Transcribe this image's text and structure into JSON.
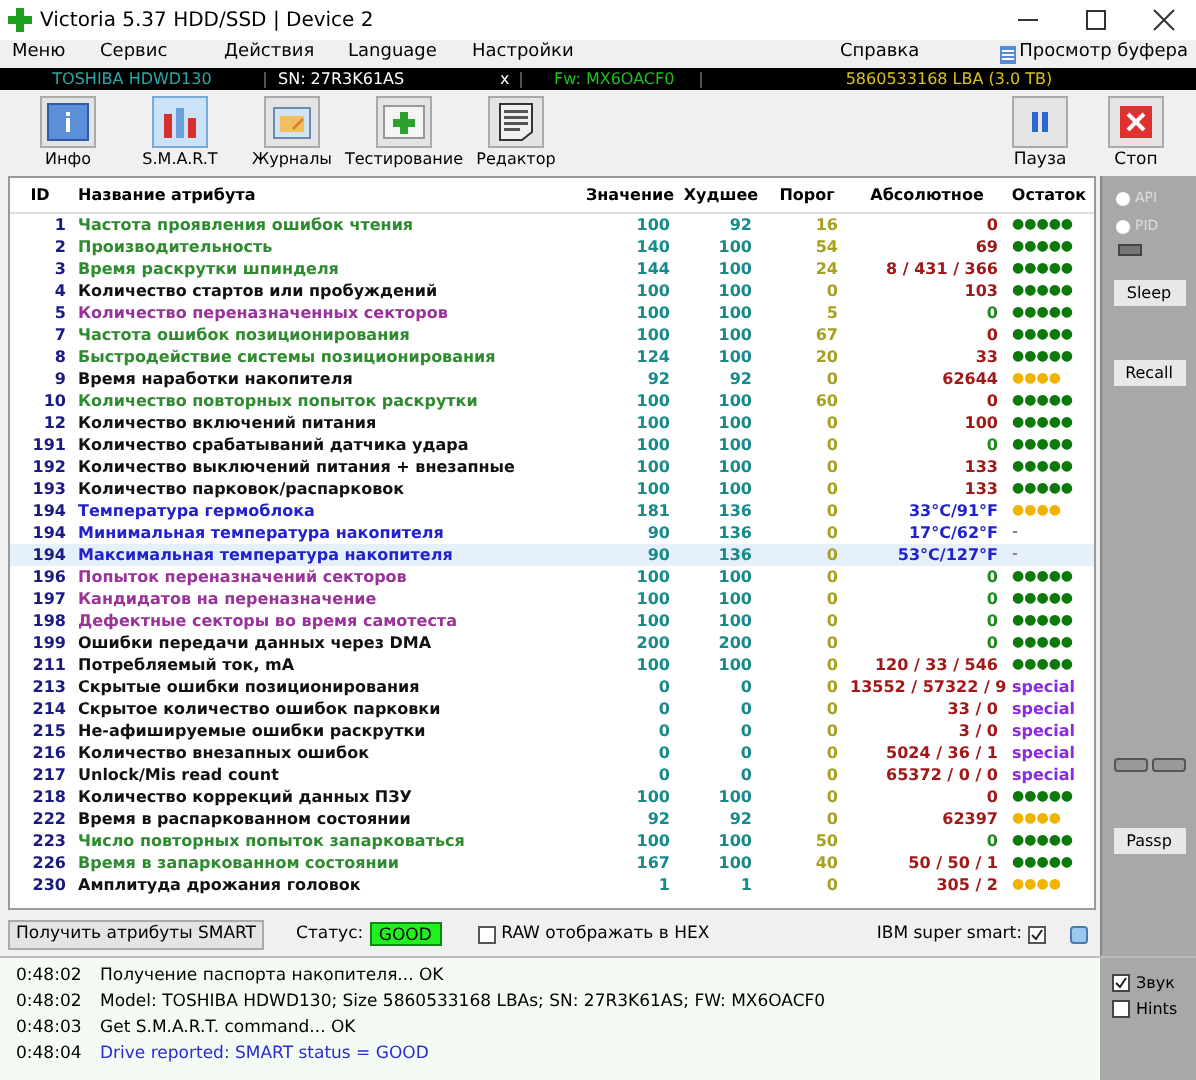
{
  "window": {
    "title": "Victoria 5.37 HDD/SSD | Device 2"
  },
  "menu": [
    "Меню",
    "Сервис",
    "Действия",
    "Language",
    "Настройки",
    "Справка"
  ],
  "clipboard_button": "Просмотр буфера",
  "drive_bar": {
    "model": "TOSHIBA HDWD130",
    "serial": "SN: 27R3K61AS",
    "close": "x",
    "firmware": "Fw: MX6OACF0",
    "capacity": "5860533168 LBA (3.0 TB)"
  },
  "toolbar": [
    {
      "label": "Инфо",
      "kind": "info",
      "selected": false
    },
    {
      "label": "S.M.A.R.T",
      "kind": "smart",
      "selected": true
    },
    {
      "label": "Журналы",
      "kind": "logs",
      "selected": false
    },
    {
      "label": "Тестирование",
      "kind": "test",
      "selected": false
    },
    {
      "label": "Редактор",
      "kind": "editor",
      "selected": false
    }
  ],
  "toolbar_right": [
    {
      "label": "Пауза",
      "kind": "pause"
    },
    {
      "label": "Стоп",
      "kind": "stop"
    }
  ],
  "table": {
    "columns": [
      "ID",
      "Название атрибута",
      "Значение",
      "Худшее",
      "Порог",
      "Абсолютное",
      "Остаток"
    ],
    "rows": [
      {
        "id": "1",
        "name": "Частота проявления ошибок чтения",
        "color": "#2e8b2e",
        "value": "100",
        "worst": "92",
        "threshold": "16",
        "raw": {
          "text": "0",
          "kind": "bad"
        },
        "remainder": {
          "text": "●●●●●",
          "kind": "good"
        },
        "selected": false
      },
      {
        "id": "2",
        "name": "Производительность",
        "color": "#2e8b2e",
        "value": "140",
        "worst": "100",
        "threshold": "54",
        "raw": {
          "text": "69",
          "kind": "bad"
        },
        "remainder": {
          "text": "●●●●●",
          "kind": "good"
        },
        "selected": false
      },
      {
        "id": "3",
        "name": "Время раскрутки шпинделя",
        "color": "#2e8b2e",
        "value": "144",
        "worst": "100",
        "threshold": "24",
        "raw": {
          "text": "8 / 431 / 366",
          "kind": "bad"
        },
        "remainder": {
          "text": "●●●●●",
          "kind": "good"
        },
        "selected": false
      },
      {
        "id": "4",
        "name": "Количество стартов или пробуждений",
        "color": "#111111",
        "value": "100",
        "worst": "100",
        "threshold": "0",
        "raw": {
          "text": "103",
          "kind": "bad"
        },
        "remainder": {
          "text": "●●●●●",
          "kind": "good"
        },
        "selected": false
      },
      {
        "id": "5",
        "name": "Количество переназначенных секторов",
        "color": "#993399",
        "value": "100",
        "worst": "100",
        "threshold": "5",
        "raw": {
          "text": "0",
          "kind": "ok"
        },
        "remainder": {
          "text": "●●●●●",
          "kind": "good"
        },
        "selected": false
      },
      {
        "id": "7",
        "name": "Частота ошибок позиционирования",
        "color": "#2e8b2e",
        "value": "100",
        "worst": "100",
        "threshold": "67",
        "raw": {
          "text": "0",
          "kind": "bad"
        },
        "remainder": {
          "text": "●●●●●",
          "kind": "good"
        },
        "selected": false
      },
      {
        "id": "8",
        "name": "Быстродействие системы позиционирования",
        "color": "#2e8b2e",
        "value": "124",
        "worst": "100",
        "threshold": "20",
        "raw": {
          "text": "33",
          "kind": "bad"
        },
        "remainder": {
          "text": "●●●●●",
          "kind": "good"
        },
        "selected": false
      },
      {
        "id": "9",
        "name": "Время наработки накопителя",
        "color": "#111111",
        "value": "92",
        "worst": "92",
        "threshold": "0",
        "raw": {
          "text": "62644",
          "kind": "bad"
        },
        "remainder": {
          "text": "●●●●",
          "kind": "warn"
        },
        "selected": false
      },
      {
        "id": "10",
        "name": "Количество повторных попыток раскрутки",
        "color": "#2e8b2e",
        "value": "100",
        "worst": "100",
        "threshold": "60",
        "raw": {
          "text": "0",
          "kind": "bad"
        },
        "remainder": {
          "text": "●●●●●",
          "kind": "good"
        },
        "selected": false
      },
      {
        "id": "12",
        "name": "Количество включений питания",
        "color": "#111111",
        "value": "100",
        "worst": "100",
        "threshold": "0",
        "raw": {
          "text": "100",
          "kind": "bad"
        },
        "remainder": {
          "text": "●●●●●",
          "kind": "good"
        },
        "selected": false
      },
      {
        "id": "191",
        "name": "Количество срабатываний датчика удара",
        "color": "#111111",
        "value": "100",
        "worst": "100",
        "threshold": "0",
        "raw": {
          "text": "0",
          "kind": "ok"
        },
        "remainder": {
          "text": "●●●●●",
          "kind": "good"
        },
        "selected": false
      },
      {
        "id": "192",
        "name": "Количество выключений питания + внезапные",
        "color": "#111111",
        "value": "100",
        "worst": "100",
        "threshold": "0",
        "raw": {
          "text": "133",
          "kind": "bad"
        },
        "remainder": {
          "text": "●●●●●",
          "kind": "good"
        },
        "selected": false
      },
      {
        "id": "193",
        "name": "Количество парковок/распарковок",
        "color": "#111111",
        "value": "100",
        "worst": "100",
        "threshold": "0",
        "raw": {
          "text": "133",
          "kind": "bad"
        },
        "remainder": {
          "text": "●●●●●",
          "kind": "good"
        },
        "selected": false
      },
      {
        "id": "194",
        "name": "Температура гермоблока",
        "color": "#2222cc",
        "value": "181",
        "worst": "136",
        "threshold": "0",
        "raw": {
          "text": "33°C/91°F",
          "kind": "temp"
        },
        "remainder": {
          "text": "●●●●",
          "kind": "warn"
        },
        "selected": false
      },
      {
        "id": "194",
        "name": "Минимальная температура накопителя",
        "color": "#2222cc",
        "value": "90",
        "worst": "136",
        "threshold": "0",
        "raw": {
          "text": "17°C/62°F",
          "kind": "temp"
        },
        "remainder": {
          "text": "-",
          "kind": "none"
        },
        "selected": false
      },
      {
        "id": "194",
        "name": "Максимальная температура накопителя",
        "color": "#2222cc",
        "value": "90",
        "worst": "136",
        "threshold": "0",
        "raw": {
          "text": "53°C/127°F",
          "kind": "temp"
        },
        "remainder": {
          "text": "-",
          "kind": "none"
        },
        "selected": true
      },
      {
        "id": "196",
        "name": "Попыток переназначений секторов",
        "color": "#993399",
        "value": "100",
        "worst": "100",
        "threshold": "0",
        "raw": {
          "text": "0",
          "kind": "ok"
        },
        "remainder": {
          "text": "●●●●●",
          "kind": "good"
        },
        "selected": false
      },
      {
        "id": "197",
        "name": "Кандидатов на переназначение",
        "color": "#993399",
        "value": "100",
        "worst": "100",
        "threshold": "0",
        "raw": {
          "text": "0",
          "kind": "ok"
        },
        "remainder": {
          "text": "●●●●●",
          "kind": "good"
        },
        "selected": false
      },
      {
        "id": "198",
        "name": "Дефектные секторы во время самотеста",
        "color": "#993399",
        "value": "100",
        "worst": "100",
        "threshold": "0",
        "raw": {
          "text": "0",
          "kind": "ok"
        },
        "remainder": {
          "text": "●●●●●",
          "kind": "good"
        },
        "selected": false
      },
      {
        "id": "199",
        "name": "Ошибки передачи данных через DMA",
        "color": "#111111",
        "value": "200",
        "worst": "200",
        "threshold": "0",
        "raw": {
          "text": "0",
          "kind": "ok"
        },
        "remainder": {
          "text": "●●●●●",
          "kind": "good"
        },
        "selected": false
      },
      {
        "id": "211",
        "name": "Потребляемый ток, mA",
        "color": "#111111",
        "value": "100",
        "worst": "100",
        "threshold": "0",
        "raw": {
          "text": "120 / 33 / 546",
          "kind": "bad"
        },
        "remainder": {
          "text": "●●●●●",
          "kind": "good"
        },
        "selected": false
      },
      {
        "id": "213",
        "name": "Скрытые ошибки позиционирования",
        "color": "#111111",
        "value": "0",
        "worst": "0",
        "threshold": "0",
        "raw": {
          "text": "13552 / 57322 / 9",
          "kind": "bad"
        },
        "remainder": {
          "text": "special",
          "kind": "special"
        },
        "selected": false
      },
      {
        "id": "214",
        "name": "Скрытое количество ошибок парковки",
        "color": "#111111",
        "value": "0",
        "worst": "0",
        "threshold": "0",
        "raw": {
          "text": "33 / 0",
          "kind": "bad"
        },
        "remainder": {
          "text": "special",
          "kind": "special"
        },
        "selected": false
      },
      {
        "id": "215",
        "name": "Не-афишируемые ошибки раскрутки",
        "color": "#111111",
        "value": "0",
        "worst": "0",
        "threshold": "0",
        "raw": {
          "text": "3 / 0",
          "kind": "bad"
        },
        "remainder": {
          "text": "special",
          "kind": "special"
        },
        "selected": false
      },
      {
        "id": "216",
        "name": "Количество внезапных ошибок",
        "color": "#111111",
        "value": "0",
        "worst": "0",
        "threshold": "0",
        "raw": {
          "text": "5024 / 36 / 1",
          "kind": "bad"
        },
        "remainder": {
          "text": "special",
          "kind": "special"
        },
        "selected": false
      },
      {
        "id": "217",
        "name": "Unlock/Mis read count",
        "color": "#111111",
        "value": "0",
        "worst": "0",
        "threshold": "0",
        "raw": {
          "text": "65372 / 0 / 0",
          "kind": "bad"
        },
        "remainder": {
          "text": "special",
          "kind": "special"
        },
        "selected": false
      },
      {
        "id": "218",
        "name": "Количество коррекций данных ПЗУ",
        "color": "#111111",
        "value": "100",
        "worst": "100",
        "threshold": "0",
        "raw": {
          "text": "0",
          "kind": "bad"
        },
        "remainder": {
          "text": "●●●●●",
          "kind": "good"
        },
        "selected": false
      },
      {
        "id": "222",
        "name": "Время в распаркованном состоянии",
        "color": "#111111",
        "value": "92",
        "worst": "92",
        "threshold": "0",
        "raw": {
          "text": "62397",
          "kind": "bad"
        },
        "remainder": {
          "text": "●●●●",
          "kind": "warn"
        },
        "selected": false
      },
      {
        "id": "223",
        "name": "Число повторных попыток запарковаться",
        "color": "#2e8b2e",
        "value": "100",
        "worst": "100",
        "threshold": "50",
        "raw": {
          "text": "0",
          "kind": "ok"
        },
        "remainder": {
          "text": "●●●●●",
          "kind": "good"
        },
        "selected": false
      },
      {
        "id": "226",
        "name": "Время в запаркованном состоянии",
        "color": "#2e8b2e",
        "value": "167",
        "worst": "100",
        "threshold": "40",
        "raw": {
          "text": "50 / 50 / 1",
          "kind": "bad"
        },
        "remainder": {
          "text": "●●●●●",
          "kind": "good"
        },
        "selected": false
      },
      {
        "id": "230",
        "name": "Амплитуда дрожания головок",
        "color": "#111111",
        "value": "1",
        "worst": "1",
        "threshold": "0",
        "raw": {
          "text": "305 / 2",
          "kind": "bad"
        },
        "remainder": {
          "text": "●●●●",
          "kind": "warn"
        },
        "selected": false
      }
    ]
  },
  "side_panel": {
    "radios": [
      {
        "label": "API",
        "selected": false
      },
      {
        "label": "PID",
        "selected": false
      }
    ],
    "buttons": [
      "Sleep",
      "Recall",
      "Passp"
    ]
  },
  "bottom_bar": {
    "get_button": "Получить атрибуты SMART",
    "status_label": "Статус:",
    "status": "GOOD",
    "raw_hex": {
      "label": "RAW отображать в HEX",
      "checked": false
    },
    "ibm": {
      "label": "IBM super smart:",
      "checked": true
    }
  },
  "log": [
    {
      "time": "0:48:02",
      "text": "Получение паспорта накопителя... OK",
      "kind": "normal"
    },
    {
      "time": "0:48:02",
      "text": "Model: TOSHIBA HDWD130; Size 5860533168 LBAs; SN: 27R3K61AS; FW: MX6OACF0",
      "kind": "normal"
    },
    {
      "time": "0:48:03",
      "text": "Get S.M.A.R.T. command... OK",
      "kind": "normal"
    },
    {
      "time": "0:48:04",
      "text": "Drive reported: SMART status = GOOD",
      "kind": "info"
    }
  ],
  "log_options": [
    {
      "label": "Звук",
      "checked": true
    },
    {
      "label": "Hints",
      "checked": false
    }
  ]
}
